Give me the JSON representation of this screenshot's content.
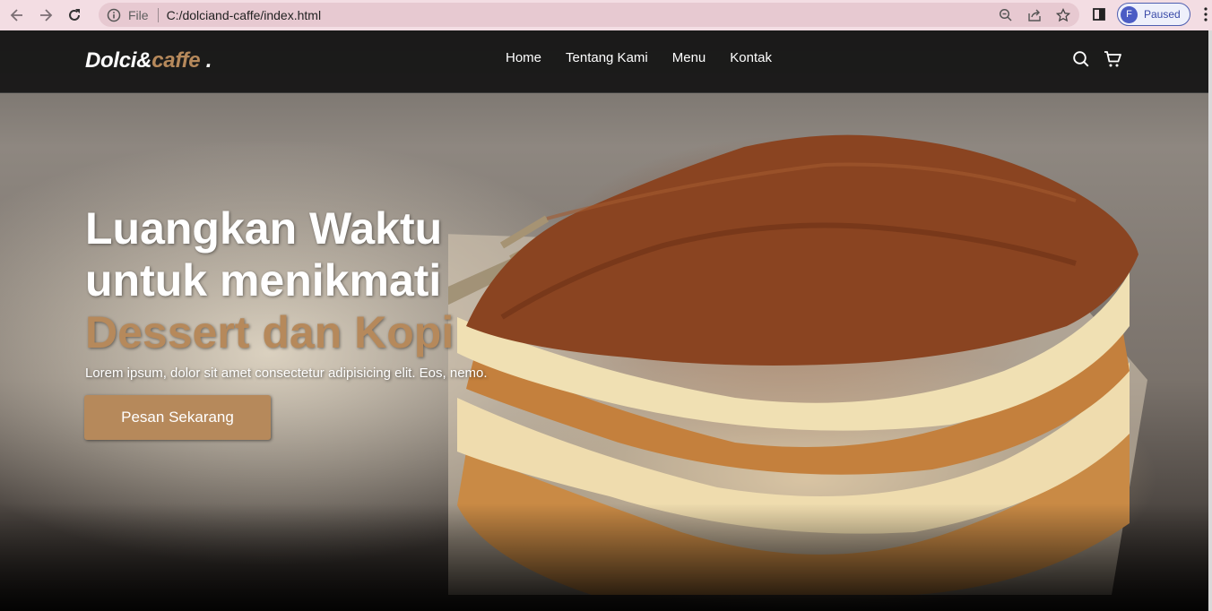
{
  "browser": {
    "scheme_label": "File",
    "url": "C:/dolciand-caffe/index.html",
    "profile_initial": "F",
    "profile_status": "Paused"
  },
  "site": {
    "logo": {
      "text_main": "Dolci&",
      "text_accent": "caffe",
      "dot": "."
    },
    "nav": {
      "items": [
        {
          "label": "Home"
        },
        {
          "label": "Tentang Kami"
        },
        {
          "label": "Menu"
        },
        {
          "label": "Kontak"
        }
      ]
    },
    "hero": {
      "title_line1": "Luangkan Waktu",
      "title_line2": "untuk menikmati",
      "title_line3": "Dessert dan Kopi",
      "subtitle": "Lorem ipsum, dolor sit amet consectetur adipisicing elit. Eos, nemo.",
      "cta_label": "Pesan Sekarang"
    }
  },
  "colors": {
    "accent": "#b6895b",
    "navbar_bg": "#141414",
    "browser_bar": "#f3dde3",
    "omnibox": "#e7c9d1"
  },
  "icons": {
    "chrome": [
      "back-arrow-icon",
      "forward-arrow-icon",
      "reload-icon",
      "info-icon",
      "zoom-icon",
      "share-icon",
      "star-icon",
      "side-panel-icon",
      "kebab-menu-icon"
    ],
    "site": [
      "search-icon",
      "cart-icon"
    ]
  }
}
